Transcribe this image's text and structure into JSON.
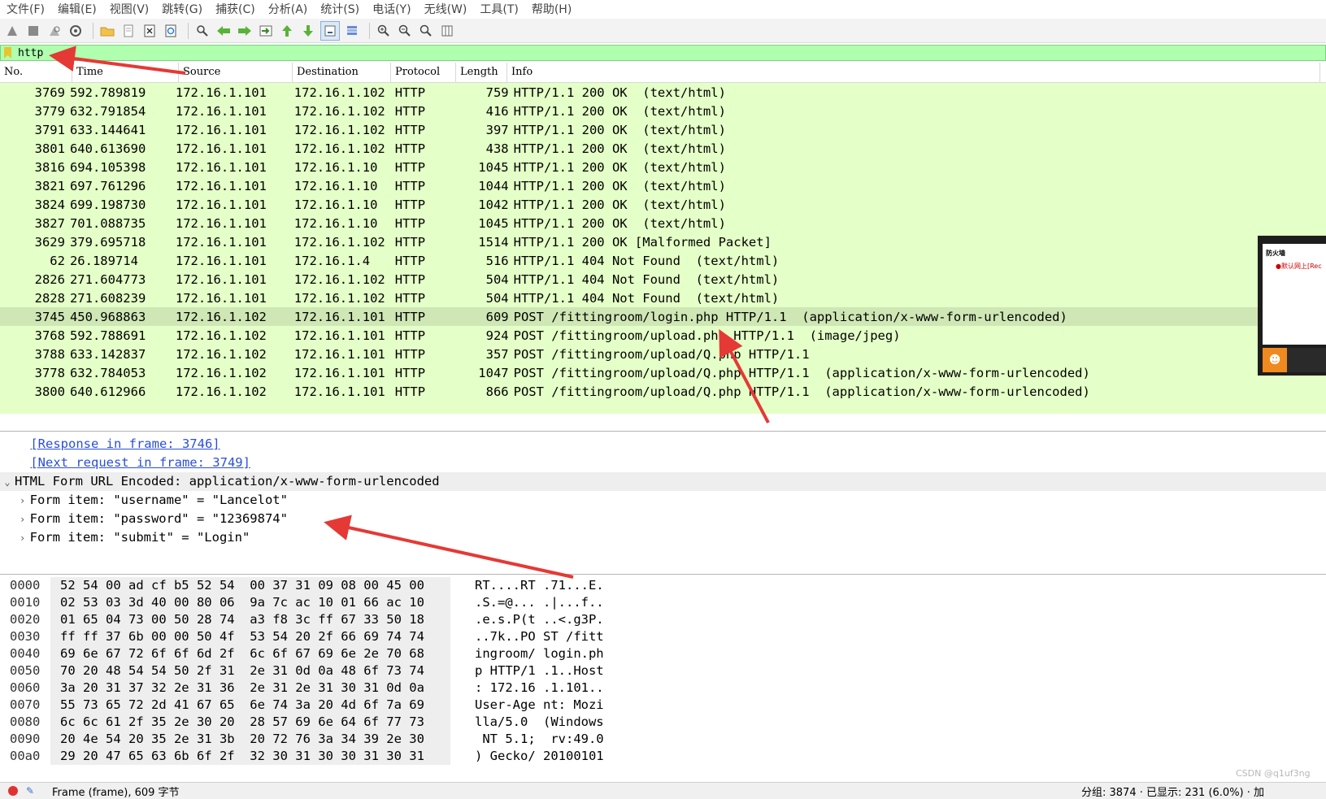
{
  "menu": [
    "文件(F)",
    "编辑(E)",
    "视图(V)",
    "跳转(G)",
    "捕获(C)",
    "分析(A)",
    "统计(S)",
    "电话(Y)",
    "无线(W)",
    "工具(T)",
    "帮助(H)"
  ],
  "toolbar": {
    "icons": [
      "shark-fin-start-icon",
      "stop-square-icon",
      "restart-fin-icon",
      "capture-options-gear-icon",
      "open-folder-icon",
      "save-file-icon",
      "close-file-icon",
      "reload-icon",
      "find-packet-icon",
      "go-back-arrow-icon",
      "go-forward-arrow-icon",
      "go-to-packet-icon",
      "go-first-packet-icon",
      "go-last-packet-icon",
      "autoscroll-icon",
      "colorize-icon",
      "zoom-in-icon",
      "zoom-out-icon",
      "normal-size-icon",
      "resize-columns-icon"
    ]
  },
  "filter": {
    "value": "http"
  },
  "packet_list": {
    "columns": [
      "No.",
      "Time",
      "Source",
      "Destination",
      "Protocol",
      "Length",
      "Info"
    ],
    "rows": [
      {
        "no": "3769",
        "time": "592.789819",
        "src": "172.16.1.101",
        "dst": "172.16.1.102",
        "proto": "HTTP",
        "len": "759",
        "info": "HTTP/1.1 200 OK  (text/html)"
      },
      {
        "no": "3779",
        "time": "632.791854",
        "src": "172.16.1.101",
        "dst": "172.16.1.102",
        "proto": "HTTP",
        "len": "416",
        "info": "HTTP/1.1 200 OK  (text/html)"
      },
      {
        "no": "3791",
        "time": "633.144641",
        "src": "172.16.1.101",
        "dst": "172.16.1.102",
        "proto": "HTTP",
        "len": "397",
        "info": "HTTP/1.1 200 OK  (text/html)"
      },
      {
        "no": "3801",
        "time": "640.613690",
        "src": "172.16.1.101",
        "dst": "172.16.1.102",
        "proto": "HTTP",
        "len": "438",
        "info": "HTTP/1.1 200 OK  (text/html)"
      },
      {
        "no": "3816",
        "time": "694.105398",
        "src": "172.16.1.101",
        "dst": "172.16.1.10",
        "proto": "HTTP",
        "len": "1045",
        "info": "HTTP/1.1 200 OK  (text/html)"
      },
      {
        "no": "3821",
        "time": "697.761296",
        "src": "172.16.1.101",
        "dst": "172.16.1.10",
        "proto": "HTTP",
        "len": "1044",
        "info": "HTTP/1.1 200 OK  (text/html)"
      },
      {
        "no": "3824",
        "time": "699.198730",
        "src": "172.16.1.101",
        "dst": "172.16.1.10",
        "proto": "HTTP",
        "len": "1042",
        "info": "HTTP/1.1 200 OK  (text/html)"
      },
      {
        "no": "3827",
        "time": "701.088735",
        "src": "172.16.1.101",
        "dst": "172.16.1.10",
        "proto": "HTTP",
        "len": "1045",
        "info": "HTTP/1.1 200 OK  (text/html)"
      },
      {
        "no": "3629",
        "time": "379.695718",
        "src": "172.16.1.101",
        "dst": "172.16.1.102",
        "proto": "HTTP",
        "len": "1514",
        "info": "HTTP/1.1 200 OK [Malformed Packet]"
      },
      {
        "no": "62",
        "time": "26.189714",
        "src": "172.16.1.101",
        "dst": "172.16.1.4",
        "proto": "HTTP",
        "len": "516",
        "info": "HTTP/1.1 404 Not Found  (text/html)"
      },
      {
        "no": "2826",
        "time": "271.604773",
        "src": "172.16.1.101",
        "dst": "172.16.1.102",
        "proto": "HTTP",
        "len": "504",
        "info": "HTTP/1.1 404 Not Found  (text/html)"
      },
      {
        "no": "2828",
        "time": "271.608239",
        "src": "172.16.1.101",
        "dst": "172.16.1.102",
        "proto": "HTTP",
        "len": "504",
        "info": "HTTP/1.1 404 Not Found  (text/html)"
      },
      {
        "no": "3745",
        "time": "450.968863",
        "src": "172.16.1.102",
        "dst": "172.16.1.101",
        "proto": "HTTP",
        "len": "609",
        "info": "POST /fittingroom/login.php HTTP/1.1  (application/x-www-form-urlencoded)",
        "selected": true
      },
      {
        "no": "3768",
        "time": "592.788691",
        "src": "172.16.1.102",
        "dst": "172.16.1.101",
        "proto": "HTTP",
        "len": "924",
        "info": "POST /fittingroom/upload.php HTTP/1.1  (image/jpeg)"
      },
      {
        "no": "3788",
        "time": "633.142837",
        "src": "172.16.1.102",
        "dst": "172.16.1.101",
        "proto": "HTTP",
        "len": "357",
        "info": "POST /fittingroom/upload/Q.php HTTP/1.1"
      },
      {
        "no": "3778",
        "time": "632.784053",
        "src": "172.16.1.102",
        "dst": "172.16.1.101",
        "proto": "HTTP",
        "len": "1047",
        "info": "POST /fittingroom/upload/Q.php HTTP/1.1  (application/x-www-form-urlencoded)"
      },
      {
        "no": "3800",
        "time": "640.612966",
        "src": "172.16.1.102",
        "dst": "172.16.1.101",
        "proto": "HTTP",
        "len": "866",
        "info": "POST /fittingroom/upload/Q.php HTTP/1.1  (application/x-www-form-urlencoded)"
      }
    ]
  },
  "detail": {
    "link_response": "[Response in frame: 3746]",
    "link_next": "[Next request in frame: 3749]",
    "form_header": "HTML Form URL Encoded: application/x-www-form-urlencoded",
    "items": [
      "Form item: \"username\" = \"Lancelot\"",
      "Form item: \"password\" = \"12369874\"",
      "Form item: \"submit\" = \"Login\""
    ]
  },
  "bytes": [
    {
      "off": "0000",
      "hex": "52 54 00 ad cf b5 52 54  00 37 31 09 08 00 45 00",
      "ascii": "RT....RT .71...E."
    },
    {
      "off": "0010",
      "hex": "02 53 03 3d 40 00 80 06  9a 7c ac 10 01 66 ac 10",
      "ascii": ".S.=@... .|...f.."
    },
    {
      "off": "0020",
      "hex": "01 65 04 73 00 50 28 74  a3 f8 3c ff 67 33 50 18",
      "ascii": ".e.s.P(t ..<.g3P."
    },
    {
      "off": "0030",
      "hex": "ff ff 37 6b 00 00 50 4f  53 54 20 2f 66 69 74 74",
      "ascii": "..7k..PO ST /fitt"
    },
    {
      "off": "0040",
      "hex": "69 6e 67 72 6f 6f 6d 2f  6c 6f 67 69 6e 2e 70 68",
      "ascii": "ingroom/ login.ph"
    },
    {
      "off": "0050",
      "hex": "70 20 48 54 54 50 2f 31  2e 31 0d 0a 48 6f 73 74",
      "ascii": "p HTTP/1 .1..Host"
    },
    {
      "off": "0060",
      "hex": "3a 20 31 37 32 2e 31 36  2e 31 2e 31 30 31 0d 0a",
      "ascii": ": 172.16 .1.101.."
    },
    {
      "off": "0070",
      "hex": "55 73 65 72 2d 41 67 65  6e 74 3a 20 4d 6f 7a 69",
      "ascii": "User-Age nt: Mozi"
    },
    {
      "off": "0080",
      "hex": "6c 6c 61 2f 35 2e 30 20  28 57 69 6e 64 6f 77 73",
      "ascii": "lla/5.0  (Windows"
    },
    {
      "off": "0090",
      "hex": "20 4e 54 20 35 2e 31 3b  20 72 76 3a 34 39 2e 30",
      "ascii": " NT 5.1;  rv:49.0"
    },
    {
      "off": "00a0",
      "hex": "29 20 47 65 63 6b 6f 2f  32 30 31 30 30 31 30 31",
      "ascii": ") Gecko/ 20100101"
    }
  ],
  "status": {
    "frame_text": "Frame (frame), 609 字节",
    "right_text": "分组: 3874 · 已显示: 231 (6.0%) · 加",
    "watermark": "CSDN @q1uf3ng"
  },
  "thumbnail": {
    "title": "防火墙",
    "subtitle": "●默认网上[Rec"
  },
  "colors": {
    "filter_bg": "#afffaf",
    "row_bg": "#e4ffc7",
    "selected_row": "#cfe7b5",
    "annotation_arrow": "#e53935",
    "link": "#2a4fd6"
  }
}
